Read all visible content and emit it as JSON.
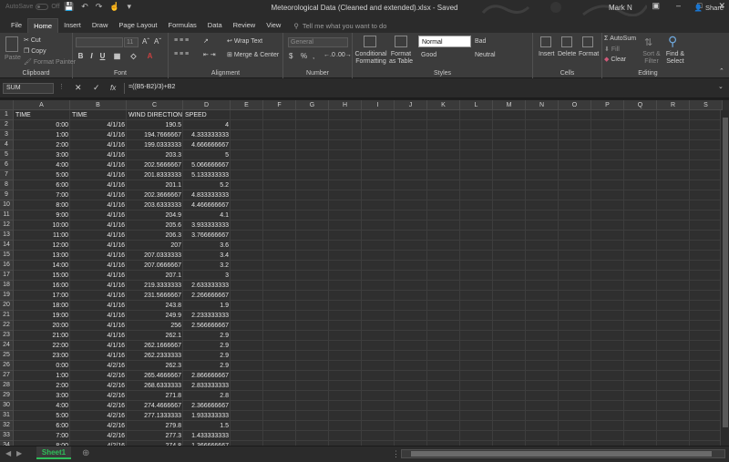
{
  "titlebar": {
    "autosave_label": "AutoSave",
    "autosave_state": "Off",
    "document_title": "Meteorological Data (Cleaned and extended).xlsx  -  Saved",
    "user_name": "Mark N"
  },
  "ribbon_tabs": [
    "File",
    "Home",
    "Insert",
    "Draw",
    "Page Layout",
    "Formulas",
    "Data",
    "Review",
    "View"
  ],
  "active_tab": "Home",
  "tell_me_placeholder": "Tell me what you want to do",
  "share_label": "Share",
  "clipboard": {
    "paste": "Paste",
    "cut": "Cut",
    "copy": "Copy",
    "format_painter": "Format Painter",
    "label": "Clipboard"
  },
  "font": {
    "size": "11",
    "label": "Font"
  },
  "alignment": {
    "wrap_text": "Wrap Text",
    "merge_center": "Merge & Center",
    "label": "Alignment"
  },
  "number": {
    "format": "General",
    "label": "Number"
  },
  "styles": {
    "conditional_formatting": "Conditional Formatting",
    "format_as_table": "Format as Table",
    "normal": "Normal",
    "bad": "Bad",
    "good": "Good",
    "neutral": "Neutral",
    "label": "Styles"
  },
  "cells_group": {
    "insert": "Insert",
    "delete": "Delete",
    "format": "Format",
    "label": "Cells"
  },
  "editing": {
    "autosum": "AutoSum",
    "fill": "Fill",
    "clear": "Clear",
    "sort_filter": "Sort & Filter",
    "find_select": "Find & Select",
    "label": "Editing"
  },
  "formula_bar": {
    "name_box": "SUM",
    "formula": "=((B5-B2)/3)+B2"
  },
  "columns": [
    "A",
    "B",
    "C",
    "D",
    "E",
    "F",
    "G",
    "H",
    "I",
    "J",
    "K",
    "L",
    "M",
    "N",
    "O",
    "P",
    "Q",
    "R",
    "S"
  ],
  "headers": [
    "TIME",
    "TIME",
    "WIND DIRECTION",
    "SPEED"
  ],
  "rows": [
    [
      "0:00",
      "4/1/16",
      "190.5",
      "4"
    ],
    [
      "1:00",
      "4/1/16",
      "194.7666667",
      "4.333333333"
    ],
    [
      "2:00",
      "4/1/16",
      "199.0333333",
      "4.666666667"
    ],
    [
      "3:00",
      "4/1/16",
      "203.3",
      "5"
    ],
    [
      "4:00",
      "4/1/16",
      "202.5666667",
      "5.066666667"
    ],
    [
      "5:00",
      "4/1/16",
      "201.8333333",
      "5.133333333"
    ],
    [
      "6:00",
      "4/1/16",
      "201.1",
      "5.2"
    ],
    [
      "7:00",
      "4/1/16",
      "202.3666667",
      "4.833333333"
    ],
    [
      "8:00",
      "4/1/16",
      "203.6333333",
      "4.466666667"
    ],
    [
      "9:00",
      "4/1/16",
      "204.9",
      "4.1"
    ],
    [
      "10:00",
      "4/1/16",
      "205.6",
      "3.933333333"
    ],
    [
      "11:00",
      "4/1/16",
      "206.3",
      "3.766666667"
    ],
    [
      "12:00",
      "4/1/16",
      "207",
      "3.6"
    ],
    [
      "13:00",
      "4/1/16",
      "207.0333333",
      "3.4"
    ],
    [
      "14:00",
      "4/1/16",
      "207.0666667",
      "3.2"
    ],
    [
      "15:00",
      "4/1/16",
      "207.1",
      "3"
    ],
    [
      "16:00",
      "4/1/16",
      "219.3333333",
      "2.633333333"
    ],
    [
      "17:00",
      "4/1/16",
      "231.5666667",
      "2.266666667"
    ],
    [
      "18:00",
      "4/1/16",
      "243.8",
      "1.9"
    ],
    [
      "19:00",
      "4/1/16",
      "249.9",
      "2.233333333"
    ],
    [
      "20:00",
      "4/1/16",
      "256",
      "2.566666667"
    ],
    [
      "21:00",
      "4/1/16",
      "262.1",
      "2.9"
    ],
    [
      "22:00",
      "4/1/16",
      "262.1666667",
      "2.9"
    ],
    [
      "23:00",
      "4/1/16",
      "262.2333333",
      "2.9"
    ],
    [
      "0:00",
      "4/2/16",
      "262.3",
      "2.9"
    ],
    [
      "1:00",
      "4/2/16",
      "265.4666667",
      "2.866666667"
    ],
    [
      "2:00",
      "4/2/16",
      "268.6333333",
      "2.833333333"
    ],
    [
      "3:00",
      "4/2/16",
      "271.8",
      "2.8"
    ],
    [
      "4:00",
      "4/2/16",
      "274.4666667",
      "2.366666667"
    ],
    [
      "5:00",
      "4/2/16",
      "277.1333333",
      "1.933333333"
    ],
    [
      "6:00",
      "4/2/16",
      "279.8",
      "1.5"
    ],
    [
      "7:00",
      "4/2/16",
      "277.3",
      "1.433333333"
    ],
    [
      "8:00",
      "4/2/16",
      "274.8",
      "1.366666667"
    ],
    [
      "9:00",
      "4/2/16",
      "272.3",
      "1.3"
    ]
  ],
  "sheet_tabs": [
    "Sheet1"
  ],
  "colors": {
    "accent_green": "#2fbf5a",
    "ribbon_bg": "#3c3c3c",
    "grid_bg": "#2f2f2f"
  }
}
